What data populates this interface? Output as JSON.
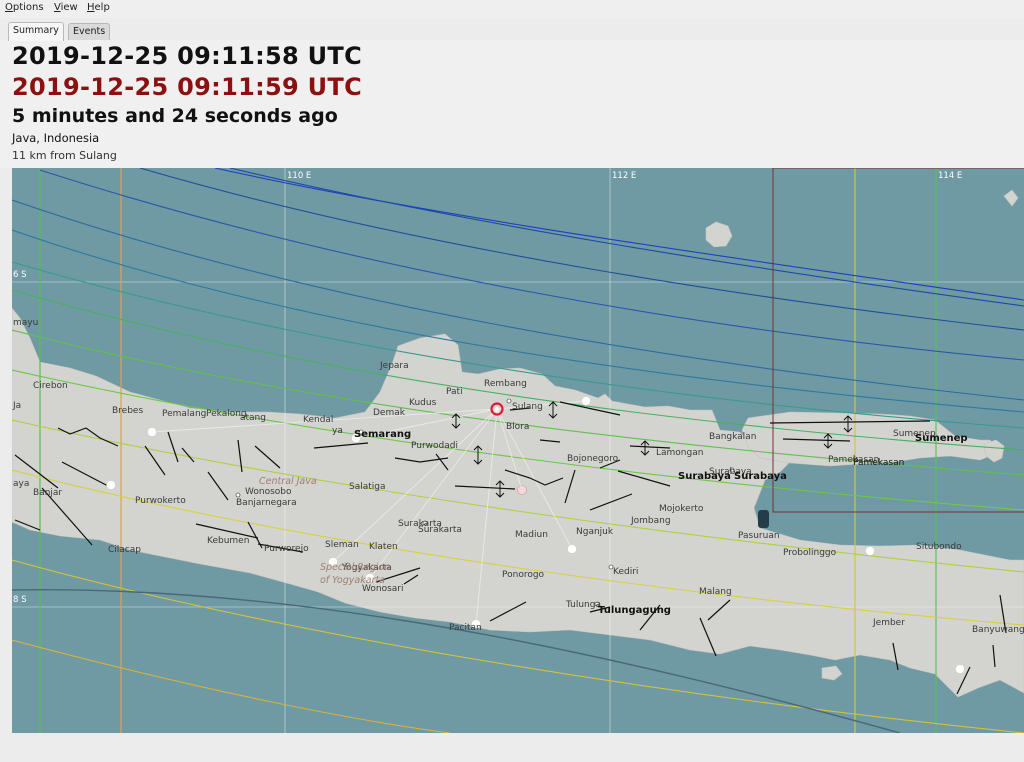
{
  "menu": {
    "options": "Options",
    "view": "View",
    "help": "Help"
  },
  "tabs": [
    {
      "label": "Summary",
      "active": true
    },
    {
      "label": "Events",
      "active": false
    }
  ],
  "event": {
    "time_origin": "2019-12-25 09:11:58 UTC",
    "time_update": "2019-12-25 09:11:59 UTC",
    "ago": "5 minutes and 24 seconds ago",
    "region": "Java, Indonesia",
    "distance": "11 km from Sulang"
  },
  "map": {
    "grid_labels": {
      "lon110": "110 E",
      "lon112": "112 E",
      "lon114": "114 E",
      "lat6": "6 S",
      "lat8": "8 S"
    },
    "place_labels": {
      "jepara": "Jepara",
      "kudus": "Kudus",
      "pati": "Pati",
      "rembang": "Rembang",
      "demak": "Demak",
      "sulang": "Sulang",
      "blora": "Blora",
      "semarang": "Semarang",
      "kendal": "Kendal",
      "purwodadi": "Purwodadi",
      "bojonegoro": "Bojonegoro",
      "lamongan": "Lamongan",
      "bangkalan": "Bangkalan",
      "sumenep": "Sumenep",
      "sumenep2": "Sumenep",
      "pamekasan": "Pamekasan",
      "pamekasan2": "Pamekasan",
      "surabaya": "Surabaya",
      "surabaya2": "Surabaya",
      "surabaya3": "Surabaya",
      "mojokerto": "Mojokerto",
      "jombang": "Jombang",
      "pasuruan": "Pasuruan",
      "probolinggo": "Probolinggo",
      "situbondo": "Situbondo",
      "cirebon": "Cirebon",
      "brebes": "Brebes",
      "pemalang": "Pemalang",
      "pekalongan": "Pekalong",
      "batang": "atang",
      "tegal": "aya",
      "salatiga": "Salatiga",
      "central_java": "Central Java",
      "wonosobo": "Wonosobo",
      "banjarnegara": "Banjarnegara",
      "purwokerto": "Purwokerto",
      "banjar": "Banjar",
      "cilacap": "Cilacap",
      "kebumen": "Kebumen",
      "purworejo": "Purworejo",
      "sleman": "Sleman",
      "yogyakarta": "Yogyakarta",
      "special_region": "Special Region",
      "of_yogyakarta": "of Yogyakarta",
      "klaten": "Klaten",
      "surakarta": "Surakarta",
      "surakarta2": "Surakarta",
      "wonosari": "Wonosari",
      "madiun": "Madiun",
      "nganjuk": "Nganjuk",
      "kediri": "Kediri",
      "ponorogo": "Ponorogo",
      "tulungagung": "Tulungagung",
      "tulungagung2": "Tulunga",
      "pacitan": "Pacitan",
      "malang": "Malang",
      "jember": "Jember",
      "banyuwangi": "Banyuwang",
      "indramayu": "mayu",
      "java_w": "Ja",
      "jateng_w": "ya"
    },
    "colors": {
      "sea": "#6f9aa3",
      "land": "#d3d3d0",
      "epicenter": "#e01a35",
      "fault": "#111111",
      "grid": "#ffffff"
    }
  }
}
